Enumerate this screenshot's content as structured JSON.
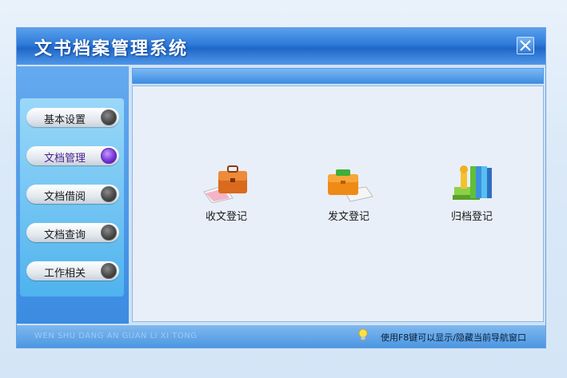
{
  "window": {
    "title": "文书档案管理系统"
  },
  "sidebar": {
    "items": [
      {
        "label": "基本设置",
        "active": false
      },
      {
        "label": "文档管理",
        "active": true
      },
      {
        "label": "文档借阅",
        "active": false
      },
      {
        "label": "文档查询",
        "active": false
      },
      {
        "label": "工作相关",
        "active": false
      }
    ]
  },
  "main": {
    "items": [
      {
        "label": "收文登记",
        "icon": "briefcase-with-papers-icon"
      },
      {
        "label": "发文登记",
        "icon": "orange-folder-icon"
      },
      {
        "label": "归档登记",
        "icon": "archive-binders-icon"
      }
    ]
  },
  "statusbar": {
    "watermark": "WEN SHU DANG AN GUAN LI XI TONG",
    "hint": "使用F8键可以显示/隐藏当前导航窗口"
  },
  "colors": {
    "active_dot": "#7a36d8",
    "inactive_dot": "#4a4a4a",
    "title_bar": "#2d7ad8"
  }
}
